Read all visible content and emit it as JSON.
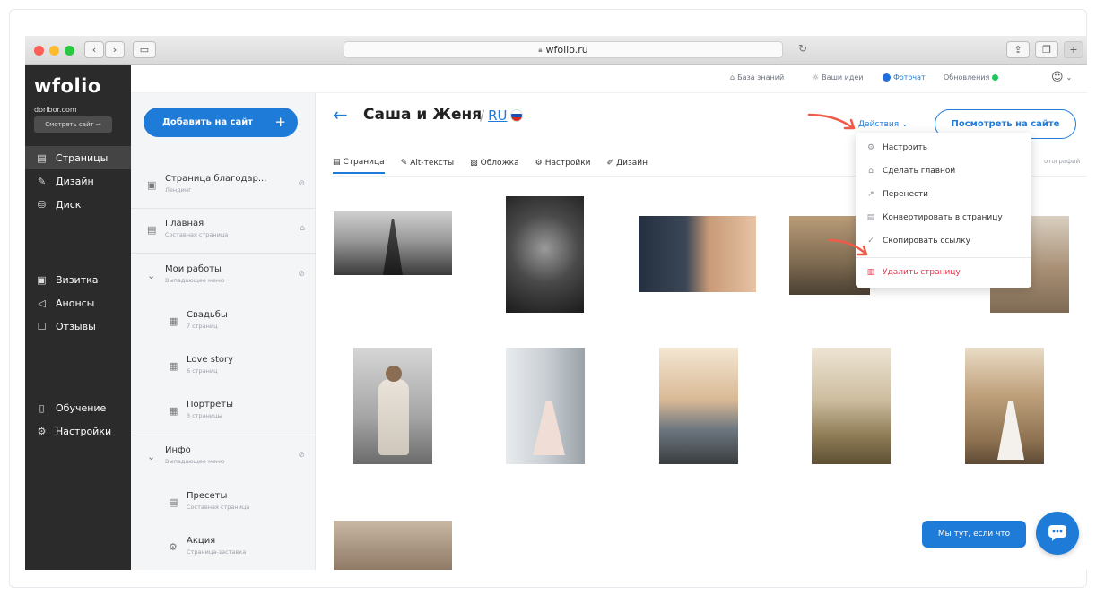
{
  "browser": {
    "url": "wfolio.ru",
    "lock_icon": "lock-icon"
  },
  "sidebar": {
    "logo": "wfolio",
    "domain": "doribor.com",
    "view_site": "Смотреть сайт →",
    "nav": [
      {
        "label": "Страницы",
        "icon": "pages-icon",
        "active": true
      },
      {
        "label": "Дизайн",
        "icon": "brush-icon"
      },
      {
        "label": "Диск",
        "icon": "disk-icon"
      },
      {
        "label": "Визитка",
        "icon": "card-icon"
      },
      {
        "label": "Анонсы",
        "icon": "megaphone-icon"
      },
      {
        "label": "Отзывы",
        "icon": "chat-icon"
      },
      {
        "label": "Обучение",
        "icon": "book-icon"
      },
      {
        "label": "Настройки",
        "icon": "gear-icon"
      }
    ]
  },
  "topbar": {
    "knowledge": "База знаний",
    "ideas": "Ваши идеи",
    "photochat": "Фоточат",
    "updates": "Обновления"
  },
  "pages_panel": {
    "add_button": "Добавить на сайт",
    "items": [
      {
        "title": "Страница благодар...",
        "subtitle": "Лендинг"
      },
      {
        "title": "Главная",
        "subtitle": "Составная страница"
      },
      {
        "title": "Мои работы",
        "subtitle": "Выпадающее меню"
      },
      {
        "title": "Свадьбы",
        "subtitle": "7 страниц"
      },
      {
        "title": "Love story",
        "subtitle": "6 страниц"
      },
      {
        "title": "Портреты",
        "subtitle": "3 страницы"
      },
      {
        "title": "Инфо",
        "subtitle": "Выпадающее меню"
      },
      {
        "title": "Пресеты",
        "subtitle": "Составная страница"
      },
      {
        "title": "Акция",
        "subtitle": "Страница-заставка"
      }
    ]
  },
  "main": {
    "page_title": "Саша и Женя",
    "separator": "/",
    "lang": "RU",
    "actions": "Действия",
    "view_on_site": "Посмотреть на сайте",
    "photos_label": "отографий",
    "tabs": [
      {
        "label": "Страница",
        "icon": "doc-icon"
      },
      {
        "label": "Alt-тексты",
        "icon": "edit-icon"
      },
      {
        "label": "Обложка",
        "icon": "image-icon"
      },
      {
        "label": "Настройки",
        "icon": "gear-icon"
      },
      {
        "label": "Дизайн",
        "icon": "brush-icon"
      }
    ]
  },
  "dropdown": {
    "items": [
      {
        "label": "Настроить",
        "icon": "gear-icon"
      },
      {
        "label": "Сделать главной",
        "icon": "home-icon"
      },
      {
        "label": "Перенести",
        "icon": "move-icon"
      },
      {
        "label": "Конвертировать в страницу",
        "icon": "convert-icon"
      },
      {
        "label": "Скопировать ссылку",
        "icon": "link-icon"
      },
      {
        "label": "Удалить страницу",
        "icon": "trash-icon",
        "danger": true
      }
    ]
  },
  "chat": {
    "pill": "Мы тут, если что"
  },
  "colors": {
    "accent": "#1e7bd8",
    "danger": "#e0364a",
    "arrow": "#f05a4a"
  }
}
